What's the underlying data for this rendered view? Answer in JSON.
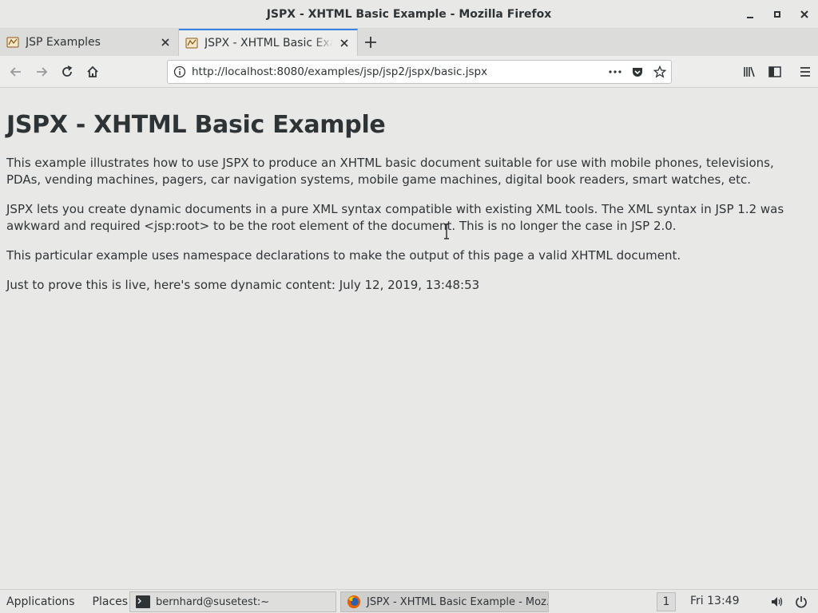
{
  "window": {
    "title": "JSPX - XHTML Basic Example - Mozilla Firefox"
  },
  "tabs": [
    {
      "label": "JSP Examples",
      "active": false
    },
    {
      "label": "JSPX - XHTML Basic Example",
      "active": true
    }
  ],
  "navigation": {
    "url": "http://localhost:8080/examples/jsp/jsp2/jspx/basic.jspx"
  },
  "page": {
    "heading": "JSPX - XHTML Basic Example",
    "paragraphs": [
      "This example illustrates how to use JSPX to produce an XHTML basic document suitable for use with mobile phones, televisions, PDAs, vending machines, pagers, car navigation systems, mobile game machines, digital book readers, smart watches, etc.",
      "JSPX lets you create dynamic documents in a pure XML syntax compatible with existing XML tools. The XML syntax in JSP 1.2 was awkward and required <jsp:root> to be the root element of the document. This is no longer the case in JSP 2.0.",
      "This particular example uses namespace declarations to make the output of this page a valid XHTML document.",
      "Just to prove this is live, here's some dynamic content: July 12, 2019, 13:48:53"
    ]
  },
  "panel": {
    "applications": "Applications",
    "places": "Places",
    "tasks": [
      {
        "label": "bernhard@susetest:~",
        "icon": "terminal-icon"
      },
      {
        "label": "JSPX - XHTML Basic Example - Moz...",
        "icon": "firefox-icon"
      }
    ],
    "workspace": "1",
    "clock": "Fri 13:49"
  },
  "colors": {
    "accent": "#3584e4",
    "background": "#e8e8e7",
    "text": "#2e3436"
  }
}
